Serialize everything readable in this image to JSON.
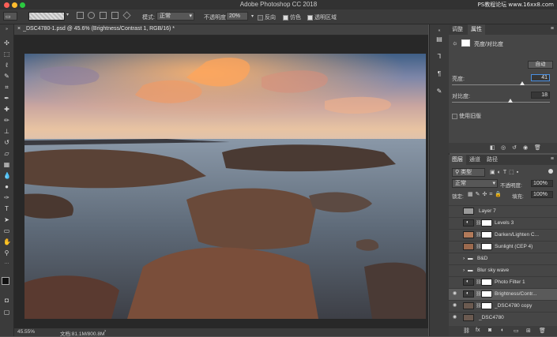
{
  "window": {
    "title": "Adobe Photoshop CC 2018",
    "watermark": "PS教程论坛 www.16xx8.com"
  },
  "options_bar": {
    "mode_label": "模式:",
    "mode_value": "正常",
    "opacity_label": "不透明度:",
    "opacity_value": "20%",
    "reverse_label": "反向",
    "dither_label": "仿色",
    "transparency_label": "透明区域"
  },
  "document": {
    "tab_title": "_DSC4780-1.psd @ 45.6% (Brightness/Contrast 1, RGB/16) *",
    "zoom": "45.55%",
    "doc_size": "文档:81.1M/800.8M"
  },
  "properties_panel": {
    "tabs": [
      "调整",
      "属性"
    ],
    "active_tab": "属性",
    "adjustment_title": "亮度/对比度",
    "auto_button": "自动",
    "brightness_label": "亮度:",
    "brightness_value": "41",
    "brightness_level": 0.72,
    "contrast_label": "对比度:",
    "contrast_value": "18",
    "contrast_level": 0.6,
    "legacy_label": "使用旧版"
  },
  "layers_panel": {
    "tabs": [
      "图层",
      "通道",
      "路径"
    ],
    "active_tab": "图层",
    "kind_filter": "类型",
    "blend_mode": "正常",
    "opacity_label": "不透明度:",
    "opacity_value": "100%",
    "lock_label": "锁定:",
    "fill_label": "填充:",
    "fill_value": "100%",
    "layers": [
      {
        "name": "Layer 7",
        "visible": false,
        "type": "pixel",
        "thumb": "#9a9a9a",
        "mask": false
      },
      {
        "name": "Levels 3",
        "visible": false,
        "type": "adjust",
        "thumb": "",
        "mask": true
      },
      {
        "name": "Darken/Lighten C...",
        "visible": false,
        "type": "pixel",
        "thumb": "#b27a5a",
        "mask": true
      },
      {
        "name": "Sunlight (CEP 4)",
        "visible": false,
        "type": "pixel",
        "thumb": "#9c6a4e",
        "mask": true
      },
      {
        "name": "B&D",
        "visible": false,
        "type": "group",
        "thumb": "",
        "mask": false
      },
      {
        "name": "Blur sky wave",
        "visible": false,
        "type": "group",
        "thumb": "",
        "mask": false
      },
      {
        "name": "Photo Filter 1",
        "visible": false,
        "type": "adjust",
        "thumb": "",
        "mask": true
      },
      {
        "name": "Brightness/Contr...",
        "visible": true,
        "type": "adjust",
        "thumb": "",
        "mask": true,
        "selected": true
      },
      {
        "name": "_DSC4780 copy",
        "visible": true,
        "type": "pixel",
        "thumb": "#6b5a50",
        "mask": true
      },
      {
        "name": "_DSC4780",
        "visible": true,
        "type": "pixel",
        "thumb": "#6b5a50",
        "mask": false
      }
    ]
  },
  "colors": {
    "ui_dark": "#323232",
    "panel": "#464646",
    "selected_row": "#5a5a5a",
    "accent": "#4a90e2"
  }
}
